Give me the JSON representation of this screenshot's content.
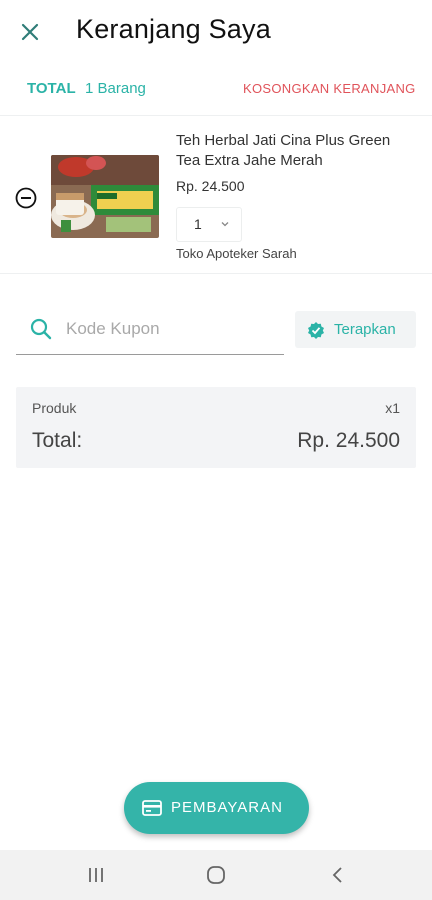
{
  "header": {
    "title": "Keranjang Saya",
    "close_icon": "close-icon"
  },
  "summary": {
    "total_label": "TOTAL",
    "item_count": "1 Barang",
    "clear_cart_label": "KOSONGKAN KERANJANG"
  },
  "cart_items": [
    {
      "name": "Teh Herbal Jati Cina Plus Green Tea Extra Jahe Merah",
      "price": "Rp. 24.500",
      "quantity": "1",
      "store": "Toko Apoteker Sarah"
    }
  ],
  "coupon": {
    "placeholder": "Kode Kupon",
    "apply_label": "Terapkan"
  },
  "order_summary": {
    "product_label": "Produk",
    "product_qty": "x1",
    "total_label": "Total:",
    "total_value": "Rp. 24.500"
  },
  "checkout": {
    "pay_label": "PEMBAYARAN",
    "pay_icon": "credit-card-icon"
  },
  "colors": {
    "accent": "#2bb3a7",
    "danger": "#e0535a",
    "pay_button": "#34b4a9"
  }
}
